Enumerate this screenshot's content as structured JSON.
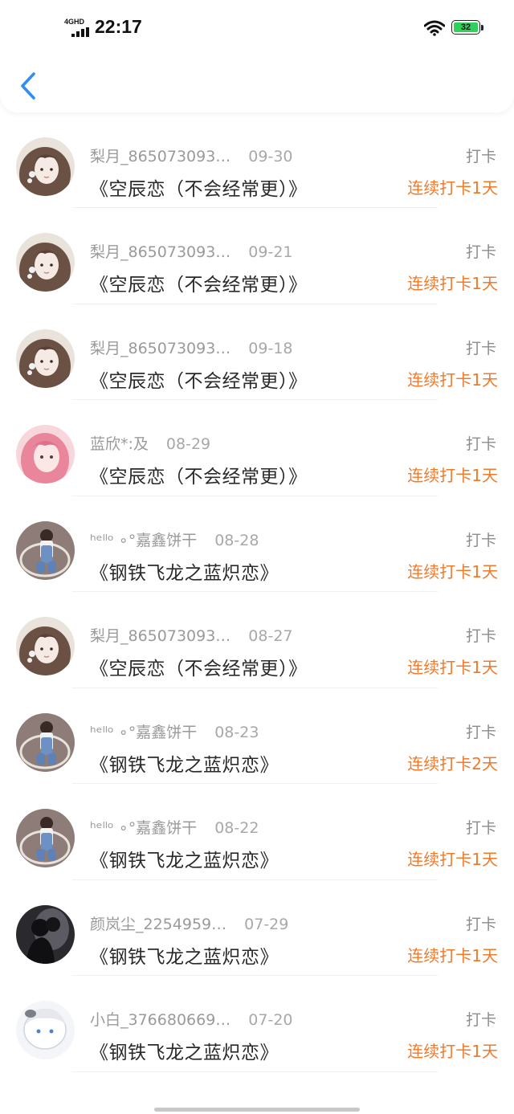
{
  "status_bar": {
    "time": "22:17",
    "network": "4GHD",
    "battery": "32"
  },
  "colors": {
    "streak": "#f07a2a",
    "back": "#2f8ff0",
    "battery_fill": "#2fd158"
  },
  "rows": [
    {
      "name": "",
      "date": "",
      "title": "《空辰恋（不会经常更）》",
      "tag": "",
      "streak": "连续打卡1天",
      "avatar": "girl-brown-avatar"
    },
    {
      "name": "梨月_865073093…",
      "date": "09-30",
      "title": "《空辰恋（不会经常更）》",
      "tag": "打卡",
      "streak": "连续打卡1天",
      "avatar": "girl-brown-avatar"
    },
    {
      "name": "梨月_865073093…",
      "date": "09-21",
      "title": "《空辰恋（不会经常更）》",
      "tag": "打卡",
      "streak": "连续打卡1天",
      "avatar": "girl-brown-avatar"
    },
    {
      "name": "梨月_865073093…",
      "date": "09-18",
      "title": "《空辰恋（不会经常更）》",
      "tag": "打卡",
      "streak": "连续打卡1天",
      "avatar": "girl-brown-avatar"
    },
    {
      "name": "蓝欣*:及",
      "date": "08-29",
      "title": "《空辰恋（不会经常更）》",
      "tag": "打卡",
      "streak": "连续打卡1天",
      "avatar": "girl-pink-avatar"
    },
    {
      "name": "ʰᵉˡˡᵒ ∘°嘉鑫饼干",
      "date": "08-28",
      "title": "《钢铁飞龙之蓝炽恋》",
      "tag": "打卡",
      "streak": "连续打卡1天",
      "avatar": "child-swing-avatar"
    },
    {
      "name": "梨月_865073093…",
      "date": "08-27",
      "title": "《空辰恋（不会经常更）》",
      "tag": "打卡",
      "streak": "连续打卡1天",
      "avatar": "girl-brown-avatar"
    },
    {
      "name": "ʰᵉˡˡᵒ ∘°嘉鑫饼干",
      "date": "08-23",
      "title": "《钢铁飞龙之蓝炽恋》",
      "tag": "打卡",
      "streak": "连续打卡2天",
      "avatar": "child-swing-avatar"
    },
    {
      "name": "ʰᵉˡˡᵒ ∘°嘉鑫饼干",
      "date": "08-22",
      "title": "《钢铁飞龙之蓝炽恋》",
      "tag": "打卡",
      "streak": "连续打卡1天",
      "avatar": "child-swing-avatar"
    },
    {
      "name": "颜岚尘_2254959…",
      "date": "07-29",
      "title": "《钢铁飞龙之蓝炽恋》",
      "tag": "打卡",
      "streak": "连续打卡1天",
      "avatar": "silhouette-avatar"
    },
    {
      "name": "小白_376680669…",
      "date": "07-20",
      "title": "《钢铁飞龙之蓝炽恋》",
      "tag": "打卡",
      "streak": "连续打卡1天",
      "avatar": "white-hair-avatar"
    }
  ]
}
